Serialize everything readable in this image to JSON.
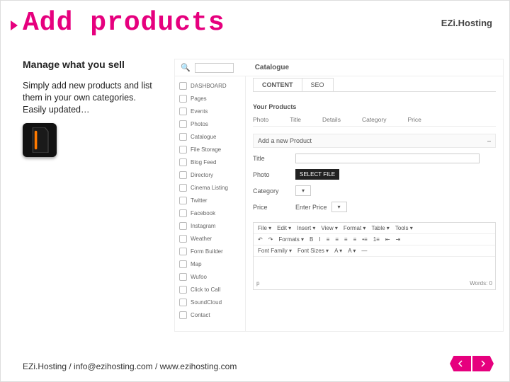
{
  "header": {
    "title": "Add products",
    "brand": "EZi.Hosting"
  },
  "left": {
    "subtitle": "Manage what you sell",
    "desc_line1": "Simply add new products and list them in your own categories.",
    "desc_line2": "Easily updated…"
  },
  "app": {
    "search_placeholder": "",
    "crumb": "Catalogue",
    "sidebar": {
      "items": [
        {
          "label": "DASHBOARD"
        },
        {
          "label": "Pages"
        },
        {
          "label": "Events"
        },
        {
          "label": "Photos"
        },
        {
          "label": "Catalogue"
        },
        {
          "label": "File Storage"
        },
        {
          "label": "Blog Feed"
        },
        {
          "label": "Directory"
        },
        {
          "label": "Cinema Listing"
        },
        {
          "label": "Twitter"
        },
        {
          "label": "Facebook"
        },
        {
          "label": "Instagram"
        },
        {
          "label": "Weather"
        },
        {
          "label": "Form Builder"
        },
        {
          "label": "Map"
        },
        {
          "label": "Wufoo"
        },
        {
          "label": "Click to Call"
        },
        {
          "label": "SoundCloud"
        },
        {
          "label": "Contact"
        }
      ]
    },
    "content": {
      "tabs": [
        {
          "label": "CONTENT",
          "active": true
        },
        {
          "label": "SEO",
          "active": false
        }
      ],
      "section_products": "Your Products",
      "table_headers": [
        "Photo",
        "Title",
        "Details",
        "Category",
        "Price"
      ],
      "section_add": "Add a new Product",
      "add_toggle": "–",
      "fields": {
        "title": {
          "label": "Title",
          "value": ""
        },
        "photo": {
          "label": "Photo",
          "button": "SELECT FILE"
        },
        "category": {
          "label": "Category",
          "toggle": "▾"
        },
        "price": {
          "label": "Price",
          "hint": "Enter Price",
          "toggle": "▾"
        }
      },
      "wysiwyg": {
        "menu": [
          "File ▾",
          "Edit ▾",
          "Insert ▾",
          "View ▾",
          "Format ▾",
          "Table ▾",
          "Tools ▾"
        ],
        "toolbar": [
          "↶",
          "↷",
          "Formats ▾",
          "B",
          "I",
          "≡",
          "≡",
          "≡",
          "≡",
          "•≡",
          "1≡",
          "⇤",
          "⇥"
        ],
        "toolbar2": [
          "Font Family ▾",
          "Font Sizes ▾",
          "A ▾",
          "A ▾",
          "—"
        ],
        "status_left": "p",
        "status_right": "Words: 0"
      }
    }
  },
  "footer": {
    "company": "EZi.Hosting",
    "sep": "  /  ",
    "email": "info@ezihosting.com",
    "url": "www.ezihosting.com"
  }
}
